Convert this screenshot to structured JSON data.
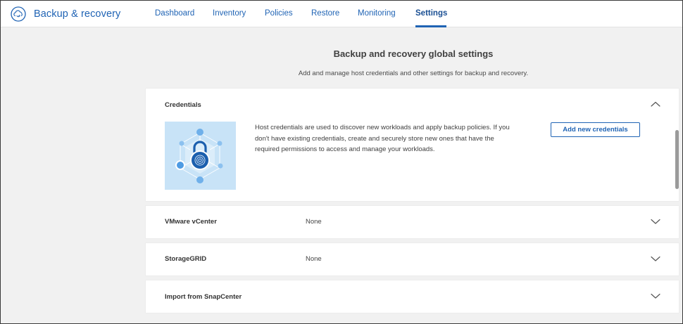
{
  "app": {
    "title": "Backup & recovery",
    "icon": "cloud-refresh-icon"
  },
  "nav": {
    "items": [
      {
        "label": "Dashboard"
      },
      {
        "label": "Inventory"
      },
      {
        "label": "Policies"
      },
      {
        "label": "Restore"
      },
      {
        "label": "Monitoring"
      },
      {
        "label": "Settings",
        "active": true
      }
    ]
  },
  "page": {
    "title": "Backup and recovery global settings",
    "subtitle": "Add and manage host credentials and other settings for backup and recovery."
  },
  "credentials": {
    "label": "Credentials",
    "expanded": true,
    "description_lines": [
      "Host credentials are used to discover new workloads and apply backup policies. If you",
      "don't have existing credentials, create and securely store new ones that have the",
      "required permissions to access and manage your workloads."
    ],
    "button_label": "Add new credentials",
    "illustration": "lock-network-icon"
  },
  "sections": [
    {
      "label": "VMware vCenter",
      "value": "None"
    },
    {
      "label": "StorageGRID",
      "value": "None"
    },
    {
      "label": "Import from SnapCenter",
      "value": ""
    }
  ],
  "colors": {
    "accent": "#1f63b4",
    "page_bg": "#f1f1f1",
    "panel_bg": "#ffffff",
    "illustration_bg": "#c8e3f7"
  }
}
